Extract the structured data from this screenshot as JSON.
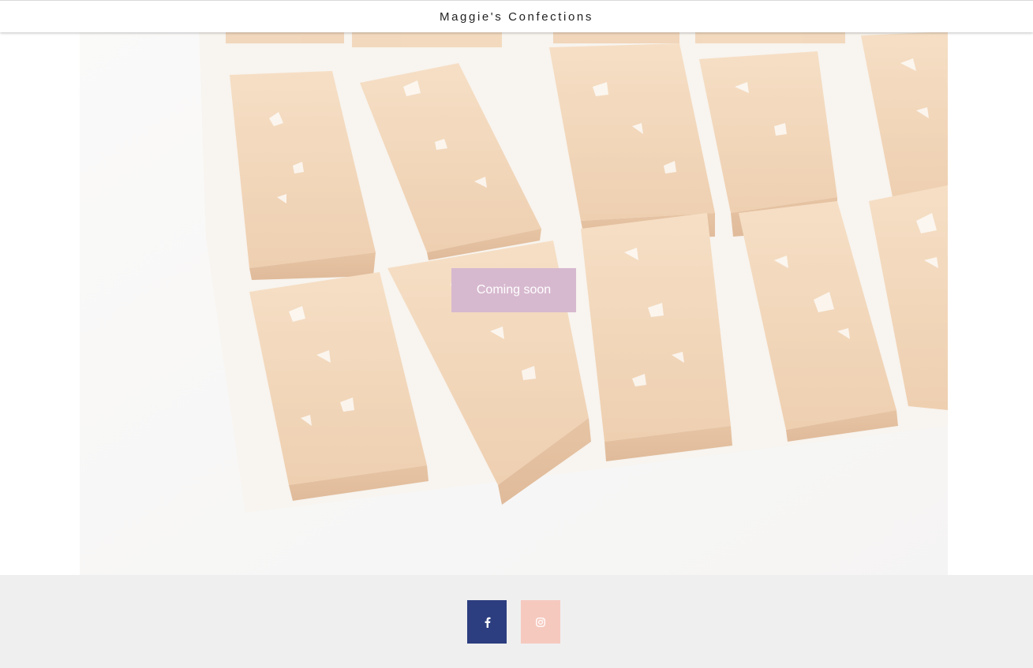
{
  "header": {
    "site_title": "Maggie's Confections"
  },
  "hero": {
    "image_subject": "salted caramel candies on parchment paper",
    "cta_label": "Coming soon"
  },
  "footer": {
    "social_links": [
      {
        "icon": "facebook-icon",
        "color": "#2c3e7f"
      },
      {
        "icon": "instagram-icon",
        "color": "#f6c9bf"
      }
    ]
  },
  "colors": {
    "cta_background": "#d7b9cf",
    "footer_background": "#efefef",
    "caramel": "#d9a06b"
  }
}
